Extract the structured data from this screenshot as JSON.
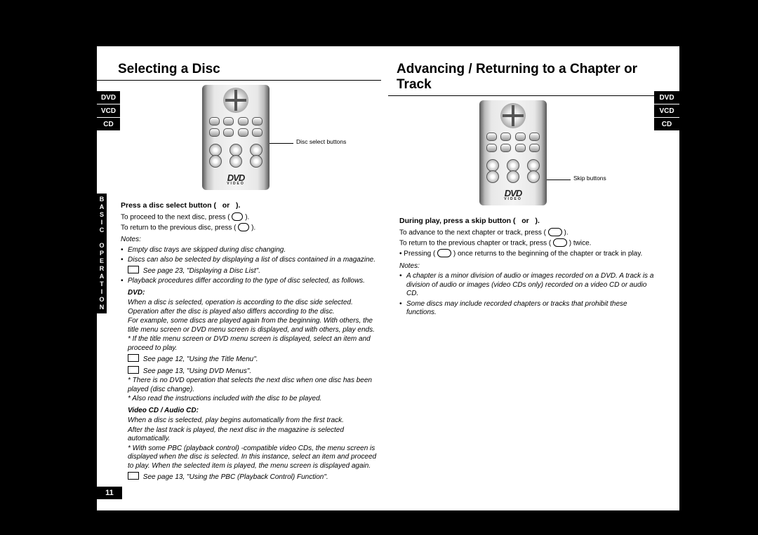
{
  "pageNumber": "11",
  "sideTabs": [
    "DVD",
    "VCD",
    "CD"
  ],
  "sectionLabel": "B\nA\nS\nI\nC\n\nO\nP\nE\nR\nA\nT\nI\nO\nN",
  "left": {
    "heading": "Selecting a Disc",
    "callout": "Disc select buttons",
    "instructionHead": "Press a disc select button (   or   ).",
    "line1a": "To proceed to the next disc, press ( ",
    "line1b": " ).",
    "line2a": "To return to the previous disc, press ( ",
    "line2b": " ).",
    "notesLabel": "Notes:",
    "n1": "Empty disc trays are skipped during disc changing.",
    "n2a": "Discs can also be selected by displaying a list of discs contained in a magazine.",
    "n2b": " See page 23, \"Displaying a Disc List\".",
    "n3": "Playback procedures differ according to the type of disc selected, as follows.",
    "dvdHead": "DVD:",
    "d1": "When a disc is selected, operation is according to the disc side selected. Operation after the disc is played also differs according to the disc.",
    "d2": "For example, some discs are played again from the beginning. With others, the title menu screen or DVD menu screen is displayed, and with others, play ends.",
    "d3": "* If the title menu screen or DVD menu screen is displayed, select an item and proceed to play.",
    "d4": " See page 12, \"Using the Title Menu\".",
    "d5": " See page 13, \"Using DVD Menus\".",
    "d6": "* There is no DVD operation that selects the next disc when one disc has been played (disc change).",
    "d7": "* Also read the instructions included with the disc to be played.",
    "vcHead": "Video CD / Audio CD:",
    "v1": "When a disc is selected, play begins automatically from the first track.",
    "v2": "After the last track is played, the next disc in the magazine is selected automatically.",
    "v3": "* With some PBC (playback control) -compatible video CDs, the menu screen is displayed when the disc is selected. In this instance, select an item and proceed to play. When the selected item is played, the menu screen is displayed again.",
    "v4": " See page 13, \"Using the PBC (Playback Control) Function\"."
  },
  "right": {
    "heading": "Advancing / Returning to a Chapter or Track",
    "callout": "Skip buttons",
    "instructionHead": "During play, press a skip button (   or   ).",
    "line1a": "To advance to the next chapter or track, press ( ",
    "line1b": " ).",
    "line2a": "To return to the previous chapter or track, press ( ",
    "line2b": " ) twice.",
    "line3a": "• Pressing ( ",
    "line3b": " ) once returns to the beginning of the chapter or track in play.",
    "notesLabel": "Notes:",
    "n1": "A chapter is a minor division of audio or images recorded on a DVD. A track is a division of audio or images (video CDs only) recorded on a video CD or audio CD.",
    "n2": "Some discs may include recorded chapters or tracks that prohibit these functions."
  }
}
